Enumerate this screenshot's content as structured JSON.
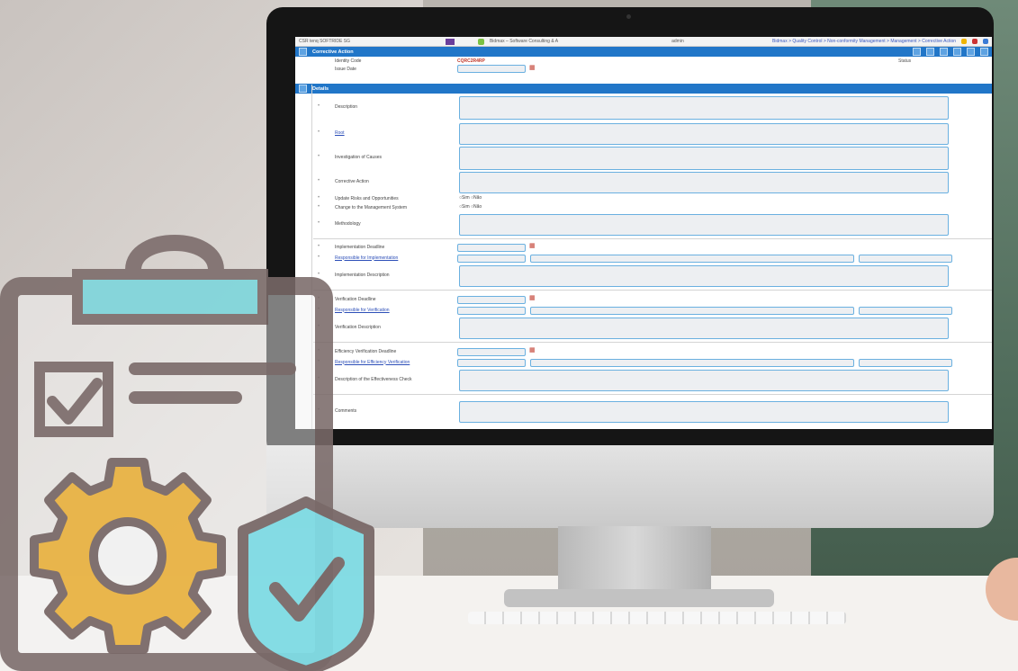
{
  "app": {
    "top_left": "CSR tenq SOFTRIDE SG",
    "company": "Bidmax – Software Consulting & A",
    "user": "admin",
    "breadcrumb": "Bidmax > Quality Control > Non-conformity Management > Management > Corrective Action"
  },
  "section": {
    "title": "Corrective Action",
    "status_label": "Status",
    "number_label": "Identity Code",
    "number_value": "CQRC2R4RP",
    "issue_label": "Issue Date"
  },
  "details": {
    "title": "Details",
    "fields": [
      {
        "label": "Description"
      },
      {
        "label": "Root",
        "link": true
      },
      {
        "label": "Investigation of Causes"
      },
      {
        "label": "Corrective Action"
      },
      {
        "label": "Update Risks and Opportunities",
        "radio": [
          "Sim",
          "Não"
        ]
      },
      {
        "label": "Change to the Management System",
        "radio": [
          "Sim",
          "Não"
        ]
      },
      {
        "label": "Methodology"
      },
      {
        "label": "Implementation Deadline"
      },
      {
        "label": "Responsible for Implementation",
        "link": true
      },
      {
        "label": "Implementation Description"
      },
      {
        "label": "Verification Deadline"
      },
      {
        "label": "Responsible for Verification",
        "link": true
      },
      {
        "label": "Verification Description"
      },
      {
        "label": "Efficiency Verification Deadline"
      },
      {
        "label": "Responsible for Efficiency Verification",
        "link": true
      },
      {
        "label": "Description of the Effectiveness Check"
      },
      {
        "label": "Comments"
      }
    ]
  },
  "colors": {
    "header_blue": "#2176c8",
    "clipboard_stroke": "#7a6a69",
    "clip_accent": "#7bd6dc",
    "gear": "#e9b344",
    "shield": "#7fdbe4"
  },
  "icons": [
    "clipboard-icon",
    "checkbox-icon",
    "gear-icon",
    "shield-check-icon",
    "calendar-icon"
  ]
}
